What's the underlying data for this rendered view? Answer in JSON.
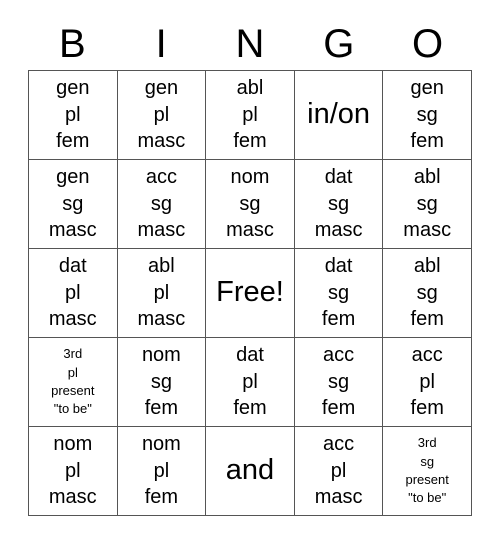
{
  "card": {
    "headers": [
      "B",
      "I",
      "N",
      "G",
      "O"
    ],
    "rows": [
      [
        {
          "style": "normal",
          "lines": [
            "gen",
            "pl",
            "fem"
          ]
        },
        {
          "style": "normal",
          "lines": [
            "gen",
            "pl",
            "masc"
          ]
        },
        {
          "style": "normal",
          "lines": [
            "abl",
            "pl",
            "fem"
          ]
        },
        {
          "style": "big",
          "lines": [
            "in/on"
          ]
        },
        {
          "style": "normal",
          "lines": [
            "gen",
            "sg",
            "fem"
          ]
        }
      ],
      [
        {
          "style": "normal",
          "lines": [
            "gen",
            "sg",
            "masc"
          ]
        },
        {
          "style": "normal",
          "lines": [
            "acc",
            "sg",
            "masc"
          ]
        },
        {
          "style": "normal",
          "lines": [
            "nom",
            "sg",
            "masc"
          ]
        },
        {
          "style": "normal",
          "lines": [
            "dat",
            "sg",
            "masc"
          ]
        },
        {
          "style": "normal",
          "lines": [
            "abl",
            "sg",
            "masc"
          ]
        }
      ],
      [
        {
          "style": "normal",
          "lines": [
            "dat",
            "pl",
            "masc"
          ]
        },
        {
          "style": "normal",
          "lines": [
            "abl",
            "pl",
            "masc"
          ]
        },
        {
          "style": "big",
          "lines": [
            "Free!"
          ]
        },
        {
          "style": "normal",
          "lines": [
            "dat",
            "sg",
            "fem"
          ]
        },
        {
          "style": "normal",
          "lines": [
            "abl",
            "sg",
            "fem"
          ]
        }
      ],
      [
        {
          "style": "small",
          "lines": [
            "3rd",
            "pl",
            "present",
            "\"to be\""
          ]
        },
        {
          "style": "normal",
          "lines": [
            "nom",
            "sg",
            "fem"
          ]
        },
        {
          "style": "normal",
          "lines": [
            "dat",
            "pl",
            "fem"
          ]
        },
        {
          "style": "normal",
          "lines": [
            "acc",
            "sg",
            "fem"
          ]
        },
        {
          "style": "normal",
          "lines": [
            "acc",
            "pl",
            "fem"
          ]
        }
      ],
      [
        {
          "style": "normal",
          "lines": [
            "nom",
            "pl",
            "masc"
          ]
        },
        {
          "style": "normal",
          "lines": [
            "nom",
            "pl",
            "fem"
          ]
        },
        {
          "style": "big",
          "lines": [
            "and"
          ]
        },
        {
          "style": "normal",
          "lines": [
            "acc",
            "pl",
            "masc"
          ]
        },
        {
          "style": "small",
          "lines": [
            "3rd",
            "sg",
            "present",
            "\"to be\""
          ]
        }
      ]
    ],
    "colors": {
      "background": "#ffffff",
      "text": "#000000",
      "grid_line": "#555555"
    }
  }
}
